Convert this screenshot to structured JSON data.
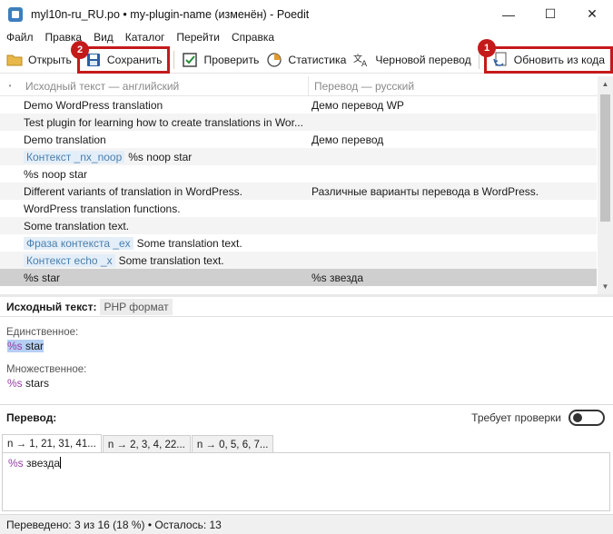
{
  "window": {
    "title": "myl10n-ru_RU.po • my-plugin-name (изменён) - Poedit",
    "minimize": "—",
    "maximize": "☐",
    "close": "✕"
  },
  "menu": [
    "Файл",
    "Правка",
    "Вид",
    "Каталог",
    "Перейти",
    "Справка"
  ],
  "toolbar": {
    "open": "Открыть",
    "save": "Сохранить",
    "validate": "Проверить",
    "stats": "Статистика",
    "pretranslate": "Черновой перевод",
    "update": "Обновить из кода",
    "badge_save": "2",
    "badge_update": "1"
  },
  "table": {
    "header_source": "Исходный текст — английский",
    "header_translation": "Перевод — русский",
    "rows": [
      {
        "context": "",
        "source": "Demo WordPress translation",
        "translation": "Демо перевод WP"
      },
      {
        "context": "",
        "source": "Test plugin for learning how to create translations in Wor...",
        "translation": ""
      },
      {
        "context": "",
        "source": "Demo translation",
        "translation": "Демо перевод"
      },
      {
        "context": "Контекст _nx_noop",
        "source": "%s noop star",
        "translation": ""
      },
      {
        "context": "",
        "source": "%s noop star",
        "translation": ""
      },
      {
        "context": "",
        "source": "Different variants of translation in WordPress.",
        "translation": "Различные варианты перевода в WordPress."
      },
      {
        "context": "",
        "source": "WordPress translation functions.",
        "translation": ""
      },
      {
        "context": "",
        "source": "Some translation text.",
        "translation": ""
      },
      {
        "context": "Фраза контекста _ex",
        "source": "Some translation text.",
        "translation": ""
      },
      {
        "context": "Контекст echo _x",
        "source": "Some translation text.",
        "translation": ""
      },
      {
        "context": "",
        "source": "%s star",
        "translation": "%s звезда"
      }
    ]
  },
  "source_panel": {
    "title": "Исходный текст:",
    "format": "PHP формат",
    "singular_label": "Единственное:",
    "singular_ph": "%s",
    "singular_rest": " star",
    "plural_label": "Множественное:",
    "plural_ph": "%s",
    "plural_rest": " stars"
  },
  "translation_panel": {
    "title": "Перевод:",
    "needs_review": "Требует проверки",
    "needs_review_on": false,
    "tabs": [
      "n → 1, 21, 31, 41...",
      "n → 2, 3, 4, 22...",
      "n → 0, 5, 6, 7..."
    ],
    "text_ph": "%s",
    "text_rest": " звезда"
  },
  "status": "Переведено: 3 из 16 (18 %) • Осталось: 13",
  "colors": {
    "highlight": "#c41a1a",
    "placeholder": "#9a3aa6",
    "selected_row": "#cfcfcf"
  }
}
